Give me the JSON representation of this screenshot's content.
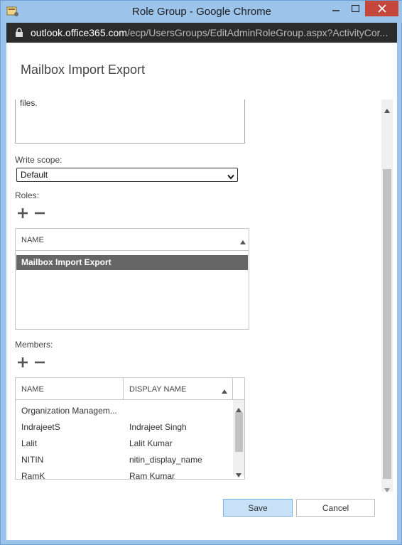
{
  "window": {
    "title": "Role Group - Google Chrome"
  },
  "address": {
    "host": "outlook.office365.com",
    "path": "/ecp/UsersGroups/EditAdminRoleGroup.aspx?ActivityCor..."
  },
  "page": {
    "title": "Mailbox Import Export"
  },
  "description": {
    "visible_text": "files."
  },
  "write_scope": {
    "label": "Write scope:",
    "selected": "Default"
  },
  "roles": {
    "label": "Roles:",
    "column": "NAME",
    "rows": [
      "Mailbox Import Export"
    ]
  },
  "members": {
    "label": "Members:",
    "columns": [
      "NAME",
      "DISPLAY NAME"
    ],
    "rows": [
      {
        "name": "Organization Managem...",
        "display": ""
      },
      {
        "name": "IndrajeetS",
        "display": "Indrajeet Singh"
      },
      {
        "name": "Lalit",
        "display": "Lalit Kumar"
      },
      {
        "name": "NITIN",
        "display": "nitin_display_name"
      },
      {
        "name": "RamK",
        "display": "Ram Kumar"
      }
    ]
  },
  "buttons": {
    "save": "Save",
    "cancel": "Cancel"
  },
  "colors": {
    "title_bar": "#9cc3ea",
    "close_button": "#c7463c",
    "selected_row": "#666666",
    "save_button": "#c9e1f7"
  }
}
